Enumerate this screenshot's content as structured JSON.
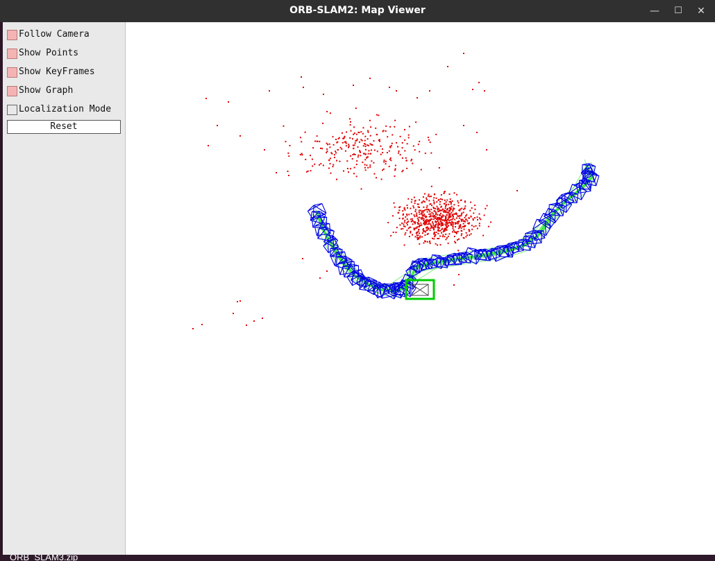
{
  "window": {
    "title": "ORB-SLAM2: Map Viewer",
    "controls": {
      "minimize": "—",
      "maximize": "☐",
      "close": "✕"
    }
  },
  "panel": {
    "options": [
      {
        "label": "Follow Camera",
        "checked": true
      },
      {
        "label": "Show Points",
        "checked": true
      },
      {
        "label": "Show KeyFrames",
        "checked": true
      },
      {
        "label": "Show Graph",
        "checked": true
      },
      {
        "label": "Localization Mode",
        "checked": false
      }
    ],
    "reset_label": "Reset"
  },
  "viewer": {
    "colors": {
      "map_points": "#e00000",
      "keyframes": "#0000e6",
      "covisibility_graph": "#33e633",
      "current_camera": "#00cc00"
    }
  },
  "taskbar": {
    "file_label": "ORB_SLAM3.zip"
  }
}
